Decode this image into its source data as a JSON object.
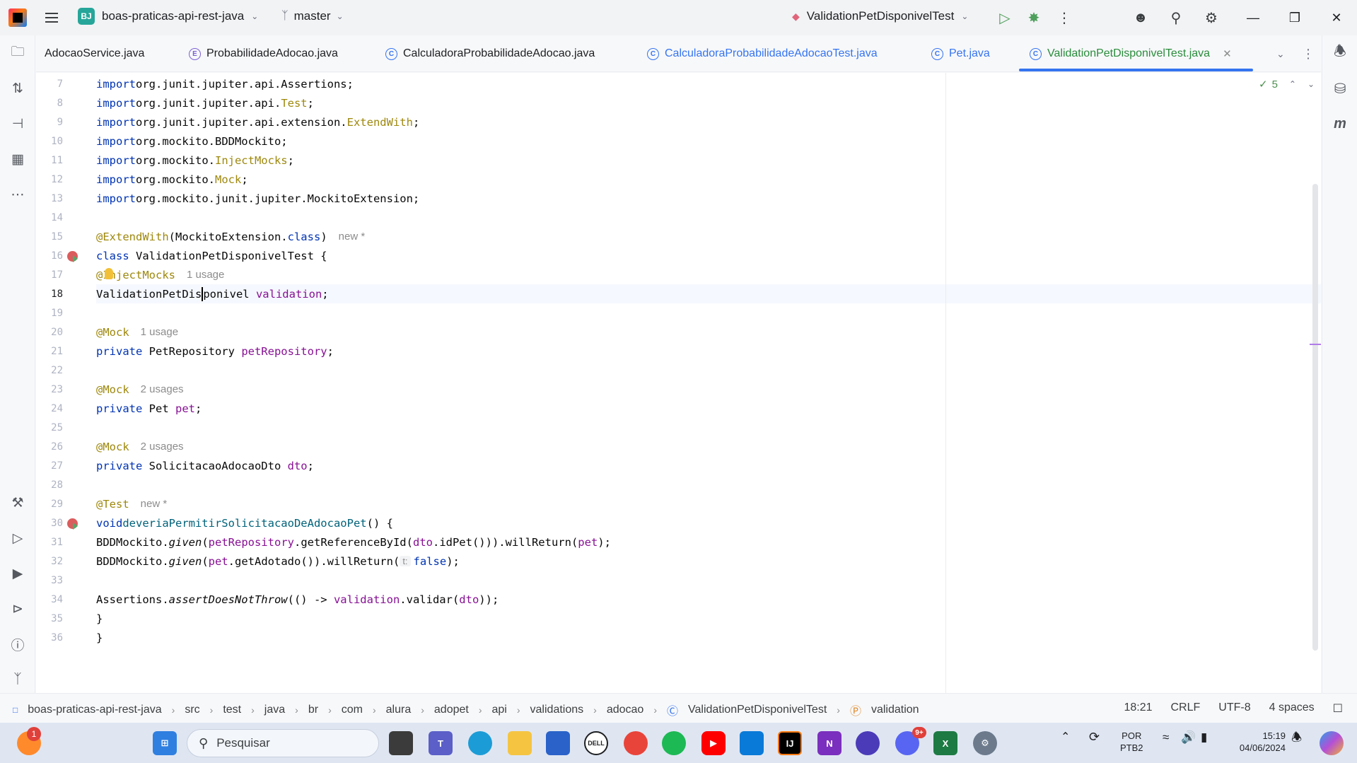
{
  "titlebar": {
    "project_badge": "BJ",
    "project_name": "boas-praticas-api-rest-java",
    "branch": "master",
    "run_config": "ValidationPetDisponivelTest"
  },
  "tabs": [
    {
      "label": "AdocaoService.java",
      "kind": "plain"
    },
    {
      "label": "ProbabilidadeAdocao.java",
      "kind": "enum",
      "icon": "E"
    },
    {
      "label": "CalculadoraProbabilidadeAdocao.java",
      "kind": "class",
      "icon": "C"
    },
    {
      "label": "CalculadoraProbabilidadeAdocaoTest.java",
      "kind": "test",
      "icon": "C"
    },
    {
      "label": "Pet.java",
      "kind": "test",
      "icon": "C"
    },
    {
      "label": "ValidationPetDisponivelTest.java",
      "kind": "active",
      "icon": "C"
    }
  ],
  "editor": {
    "inspection_count": "5",
    "lines": [
      {
        "n": "7"
      },
      {
        "n": "8"
      },
      {
        "n": "9"
      },
      {
        "n": "10"
      },
      {
        "n": "11"
      },
      {
        "n": "12"
      },
      {
        "n": "13"
      },
      {
        "n": "14"
      },
      {
        "n": "15"
      },
      {
        "n": "16"
      },
      {
        "n": "17"
      },
      {
        "n": "18"
      },
      {
        "n": "19"
      },
      {
        "n": "20"
      },
      {
        "n": "21"
      },
      {
        "n": "22"
      },
      {
        "n": "23"
      },
      {
        "n": "24"
      },
      {
        "n": "25"
      },
      {
        "n": "26"
      },
      {
        "n": "27"
      },
      {
        "n": "28"
      },
      {
        "n": "29"
      },
      {
        "n": "30"
      },
      {
        "n": "31"
      },
      {
        "n": "32"
      },
      {
        "n": "33"
      },
      {
        "n": "34"
      },
      {
        "n": "35"
      },
      {
        "n": "36"
      }
    ],
    "code": {
      "l7": "org.junit.jupiter.api.Assertions;",
      "l8a": "org.junit.jupiter.api.",
      "l8b": "Test",
      "l8c": ";",
      "l9a": "org.junit.jupiter.api.extension.",
      "l9b": "ExtendWith",
      "l9c": ";",
      "l10": "org.mockito.BDDMockito;",
      "l11a": "org.mockito.",
      "l11b": "InjectMocks",
      "l11c": ";",
      "l12a": "org.mockito.",
      "l12b": "Mock",
      "l12c": ";",
      "l13": "org.mockito.junit.jupiter.MockitoExtension;",
      "kw_import": "import",
      "l15a": "@ExtendWith",
      "l15b": "(MockitoExtension.",
      "l15c": "class",
      "l15d": ")",
      "l15hint": "new *",
      "l16a": "class",
      "l16b": " ValidationPetDisponivelTest {",
      "l17a": "@InjectMocks",
      "l17hint": "1 usage",
      "l18a": "ValidationPetDis",
      "l18b": "ponivel ",
      "l18c": "validation",
      "l18d": ";",
      "l20a": "@Mock",
      "l20hint": "1 usage",
      "l21a": "private",
      "l21b": " PetRepository ",
      "l21c": "petRepository",
      "l21d": ";",
      "l23a": "@Mock",
      "l23hint": "2 usages",
      "l24a": "private",
      "l24b": " Pet ",
      "l24c": "pet",
      "l24d": ";",
      "l26a": "@Mock",
      "l26hint": "2 usages",
      "l27a": "private",
      "l27b": " SolicitacaoAdocaoDto ",
      "l27c": "dto",
      "l27d": ";",
      "l29a": "@Test",
      "l29hint": "new *",
      "l30a": "void",
      "l30b": "deveriaPermitirSolicitacaoDeAdocaoPet",
      "l30c": "() {",
      "l31a": "BDDMockito.",
      "l31b": "given",
      "l31c": "(",
      "l31d": "petRepository",
      "l31e": ".getReferenceById(",
      "l31f": "dto",
      "l31g": ".idPet())).willReturn(",
      "l31h": "pet",
      "l31i": ");",
      "l32a": "BDDMockito.",
      "l32b": "given",
      "l32c": "(",
      "l32d": "pet",
      "l32e": ".getAdotado()).willReturn(",
      "l32inlay": "t:",
      "l32f": "false",
      "l32g": ");",
      "l34a": "Assertions.",
      "l34b": "assertDoesNotThrow",
      "l34c": "(() -> ",
      "l34d": "validation",
      "l34e": ".validar(",
      "l34f": "dto",
      "l34g": "));",
      "l35": "}",
      "l36": "}"
    }
  },
  "breadcrumbs": [
    "boas-praticas-api-rest-java",
    "src",
    "test",
    "java",
    "br",
    "com",
    "alura",
    "adopet",
    "api",
    "validations",
    "adocao",
    "ValidationPetDisponivelTest",
    "validation"
  ],
  "status": {
    "position": "18:21",
    "line_ending": "CRLF",
    "encoding": "UTF-8",
    "indent": "4 spaces"
  },
  "taskbar": {
    "search_placeholder": "Pesquisar",
    "notification_count": "1",
    "language": "POR",
    "keyboard": "PTB2",
    "time": "15:19",
    "date": "04/06/2024",
    "discord_badge": "9+"
  },
  "colors": {
    "keyword": "#0033b3",
    "annotation": "#9e880d",
    "field": "#871094",
    "active_tab": "#2a8c3c",
    "accent": "#3574f0"
  }
}
